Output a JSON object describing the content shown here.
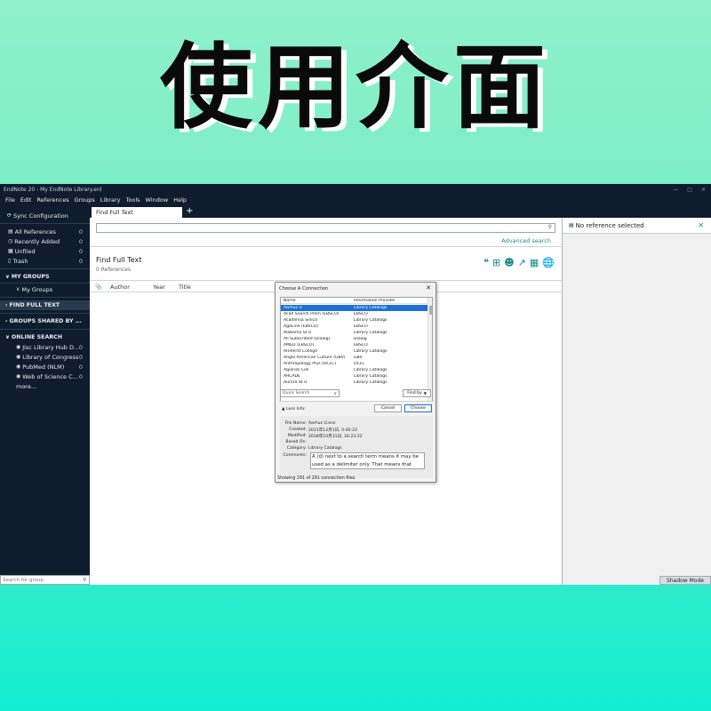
{
  "banner": {
    "title": "使用介面"
  },
  "window": {
    "title": "EndNote 20 - My EndNote Library.enl"
  },
  "menu": [
    "File",
    "Edit",
    "References",
    "Groups",
    "Library",
    "Tools",
    "Window",
    "Help"
  ],
  "sidebar": {
    "sync": "Sync Configuration",
    "items": [
      {
        "label": "All References",
        "count": "0",
        "icon": "library-icon"
      },
      {
        "label": "Recently Added",
        "count": "0",
        "icon": "clock-icon"
      },
      {
        "label": "Unfiled",
        "count": "0",
        "icon": "folder-icon"
      },
      {
        "label": "Trash",
        "count": "0",
        "icon": "trash-icon"
      }
    ],
    "my_groups_header": "MY GROUPS",
    "my_groups_item": "My Groups",
    "find_full_text_header": "FIND FULL TEXT",
    "groups_shared_header": "GROUPS SHARED BY ...",
    "online_search_header": "ONLINE SEARCH",
    "online_items": [
      {
        "label": "Jisc Library Hub D...",
        "count": "0"
      },
      {
        "label": "Library of Congress",
        "count": "0"
      },
      {
        "label": "PubMed (NLM)",
        "count": "0"
      },
      {
        "label": "Web of Science C...",
        "count": "0"
      }
    ],
    "more": "more...",
    "search_placeholder": "Search for group"
  },
  "tab": {
    "label": "Find Full Text",
    "add": "+"
  },
  "main": {
    "advanced_search": "Advanced search",
    "title": "Find Full Text",
    "count": "0 References",
    "columns": [
      "Author",
      "Year",
      "Title"
    ]
  },
  "right_panel": {
    "title": "No reference selected",
    "shadow_mode": "Shadow Mode"
  },
  "dialog": {
    "title": "Choose A Connection",
    "col_name": "Name",
    "col_provider": "Information Provider",
    "rows": [
      {
        "name": "Aarhus U",
        "provider": "Library Catalogs"
      },
      {
        "name": "Acad Search Prem (EBSCO)",
        "provider": "EBSCO"
      },
      {
        "name": "Academia Sinica",
        "provider": "Library Catalogs"
      },
      {
        "name": "AgeLine (EBSCO)",
        "provider": "EBSCO"
      },
      {
        "name": "Alabama St U",
        "provider": "Library Catalogs"
      },
      {
        "name": "All Subscribed (Dialog)",
        "provider": "Dialog"
      },
      {
        "name": "AMED (EBSCO)",
        "provider": "EBSCO"
      },
      {
        "name": "Amherst College",
        "provider": "Library Catalogs"
      },
      {
        "name": "Anglo-American Culture (GBV)",
        "provider": "GBV"
      },
      {
        "name": "Anthropology Plus (OCLC)",
        "provider": "OCLC"
      },
      {
        "name": "Aquinas Coll",
        "provider": "Library Catalogs"
      },
      {
        "name": "ARCADE",
        "provider": "Library Catalogs"
      },
      {
        "name": "Aurora St U",
        "provider": "Library Catalogs"
      }
    ],
    "quick_search": "Quick Search",
    "find_by": "Find by",
    "less_info": "Less Info:",
    "cancel": "Cancel",
    "choose": "Choose",
    "info": {
      "file_name_label": "File Name:",
      "file_name": "Aarhus U.enz",
      "created_label": "Created:",
      "created": "2021年12月1日, 0:40:33",
      "modified_label": "Modified:",
      "modified": "2018年10月31日, 16:23:22",
      "based_on_label": "Based On:",
      "based_on": "",
      "category_label": "Category:",
      "category": "Library Catalogs",
      "comments_label": "Comments:",
      "comments": "A (d) next to a search term means it may be used as a delimiter only. That means that"
    },
    "status": "Showing 291 of 291 connection files."
  },
  "colors": {
    "sidebar_bg": "#0e1c2e",
    "accent": "#1a8a88",
    "selection": "#1e6fd6"
  }
}
